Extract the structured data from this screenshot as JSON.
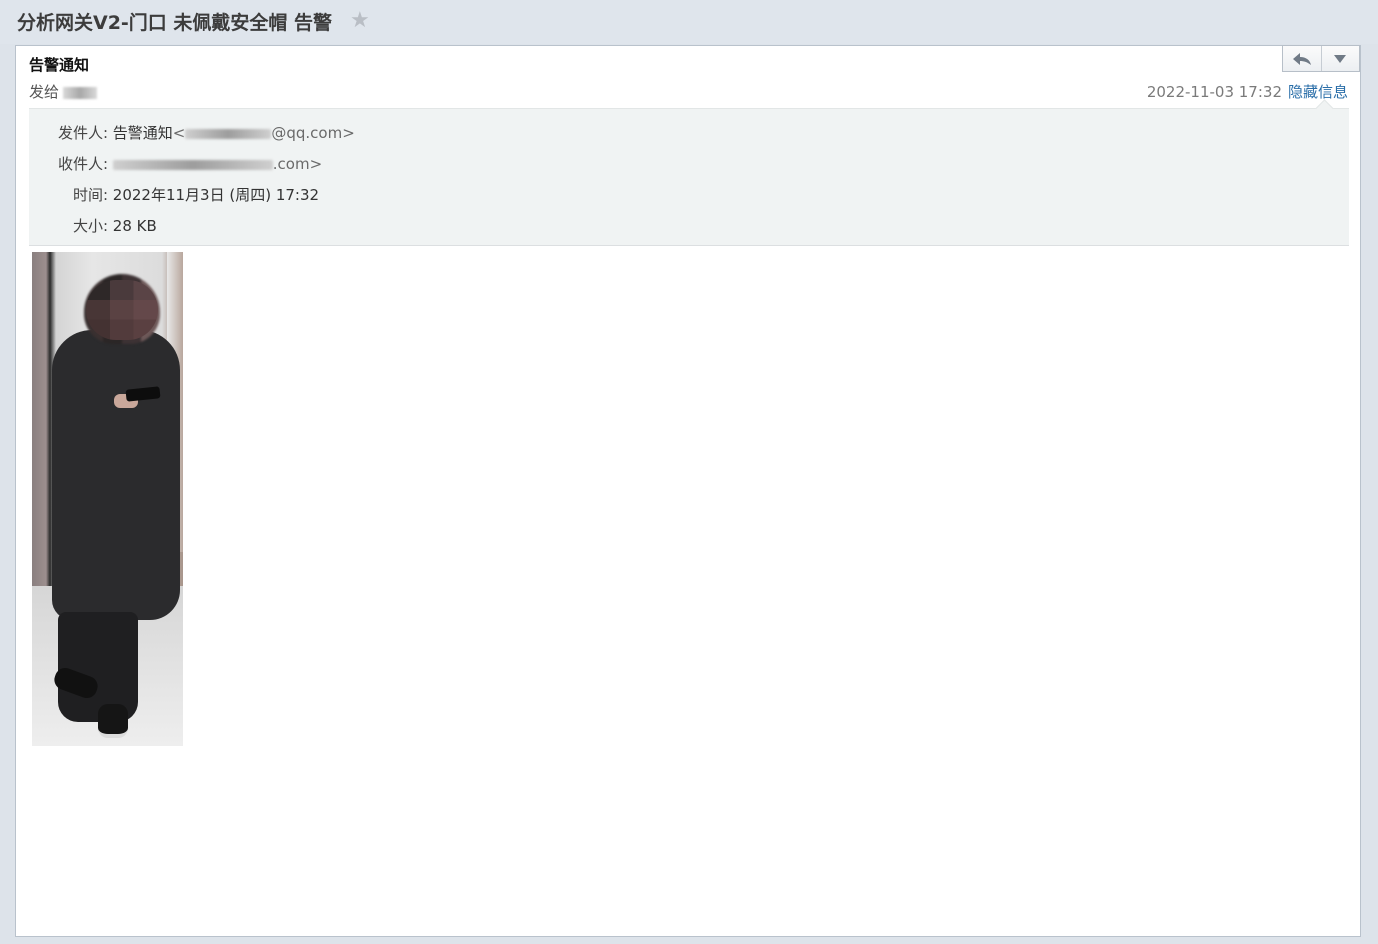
{
  "subject": "分析网关V2-门口 未佩戴安全帽 告警",
  "icons": {
    "star": "star-icon",
    "reply": "reply-icon",
    "more": "chevron-down-icon"
  },
  "header": {
    "from_name": "告警通知",
    "sent_to_label": "发给",
    "date": "2022-11-03 17:32",
    "hide_info_link": "隐藏信息"
  },
  "details": {
    "sender_label": "发件人:",
    "sender_name": "告警通知",
    "sender_email_visible": "@qq.com>",
    "recipient_label": "收件人:",
    "recipient_email_visible": ".com>",
    "time_label": "时间:",
    "time_value": "2022年11月3日 (周四) 17:32",
    "size_label": "大小:",
    "size_value": "28 KB"
  },
  "colors": {
    "link": "#2a6ea8",
    "subject_bar": "#dfe5ec",
    "details_bg": "#f0f3f3"
  }
}
